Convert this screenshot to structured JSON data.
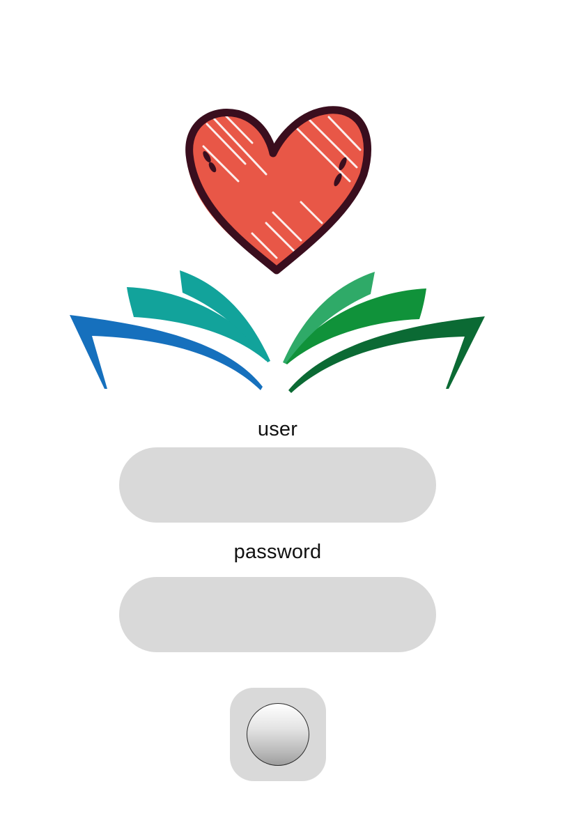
{
  "app": {
    "logo_icon": "heart-book-logo-icon"
  },
  "form": {
    "user_label": "user",
    "user_value": "",
    "password_label": "password",
    "password_value": "",
    "submit_icon": "round-knob-icon"
  },
  "colors": {
    "background": "#ffffff",
    "field_background": "#d9d9d9",
    "heart_fill": "#e85747",
    "heart_outline": "#3a0e1e",
    "page_blue": "#1670bd",
    "page_teal": "#12a39b",
    "page_green": "#10923a",
    "page_dark_green": "#0b6a34",
    "page_light_green": "#2faa68"
  }
}
